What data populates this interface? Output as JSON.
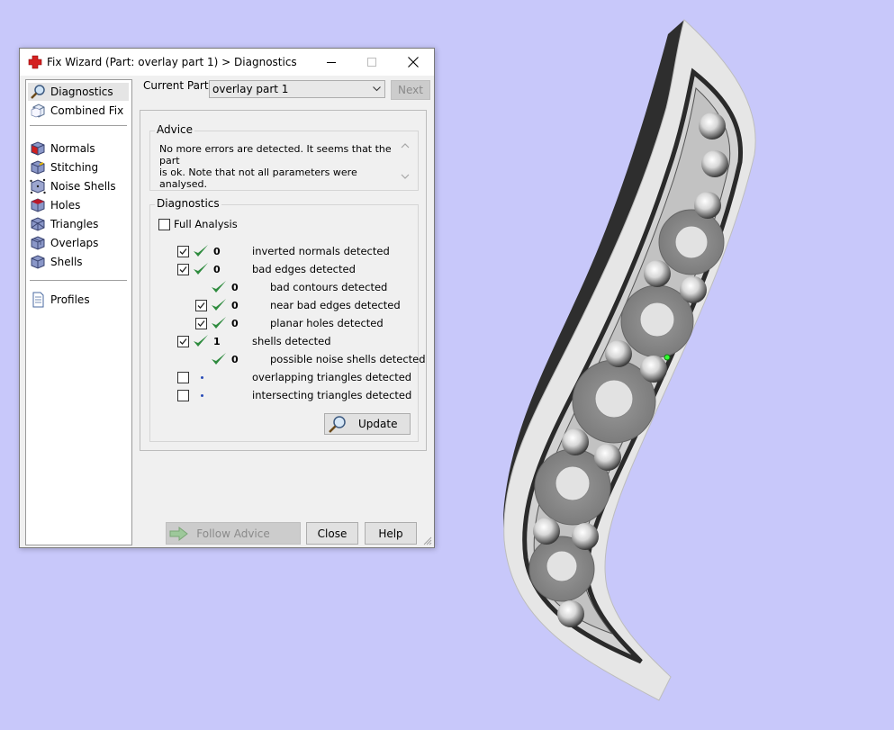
{
  "window": {
    "title": "Fix Wizard (Part: overlay part 1) > Diagnostics",
    "controls": [
      "minimize-icon",
      "maximize-icon",
      "close-icon"
    ]
  },
  "sidebar": {
    "items": [
      {
        "label": "Diagnostics",
        "icon": "magnifier-icon",
        "selected": true
      },
      {
        "label": "Combined Fix",
        "icon": "cube-wireframe-icon"
      },
      {
        "label": "Normals",
        "icon": "cube-red-icon"
      },
      {
        "label": "Stitching",
        "icon": "cube-stitch-icon"
      },
      {
        "label": "Noise Shells",
        "icon": "cube-dots-icon"
      },
      {
        "label": "Holes",
        "icon": "cube-hole-icon"
      },
      {
        "label": "Triangles",
        "icon": "cube-triangle-icon"
      },
      {
        "label": "Overlaps",
        "icon": "cube-overlap-icon"
      },
      {
        "label": "Shells",
        "icon": "cube-blue-icon"
      },
      {
        "label": "Profiles",
        "icon": "document-icon"
      }
    ]
  },
  "header": {
    "current_part_label": "Current Part:",
    "current_part_value": "overlay part 1",
    "next_label": "Next"
  },
  "advice": {
    "title": "Advice",
    "text_line1": "No more errors are detected. It seems that the part",
    "text_line2": "is ok. Note that not all parameters were analysed."
  },
  "diagnostics": {
    "title": "Diagnostics",
    "full_analysis_label": "Full Analysis",
    "full_analysis_checked": false,
    "rows": [
      {
        "count": "0",
        "label": "inverted normals detected",
        "checked": true,
        "status": "ok"
      },
      {
        "count": "0",
        "label": "bad edges detected",
        "checked": true,
        "status": "ok"
      },
      {
        "count": "0",
        "label": "bad contours detected",
        "status": "ok"
      },
      {
        "count": "0",
        "label": "near bad edges detected",
        "checked": true,
        "status": "ok"
      },
      {
        "count": "0",
        "label": "planar holes detected",
        "checked": true,
        "status": "ok"
      },
      {
        "count": "1",
        "label": "shells detected",
        "checked": true,
        "status": "ok"
      },
      {
        "count": "0",
        "label": "possible noise shells detected",
        "status": "ok"
      },
      {
        "count": "",
        "label": "overlapping triangles detected",
        "checked": false,
        "status": "pending"
      },
      {
        "count": "",
        "label": "intersecting triangles detected",
        "checked": false,
        "status": "pending"
      }
    ],
    "update_label": "Update"
  },
  "footer": {
    "follow_advice_label": "Follow Advice",
    "close_label": "Close",
    "help_label": "Help"
  },
  "colors": {
    "background": "#c8c8fa",
    "check_green": "#2e8b3e",
    "window_bg": "#f0f0f0"
  }
}
